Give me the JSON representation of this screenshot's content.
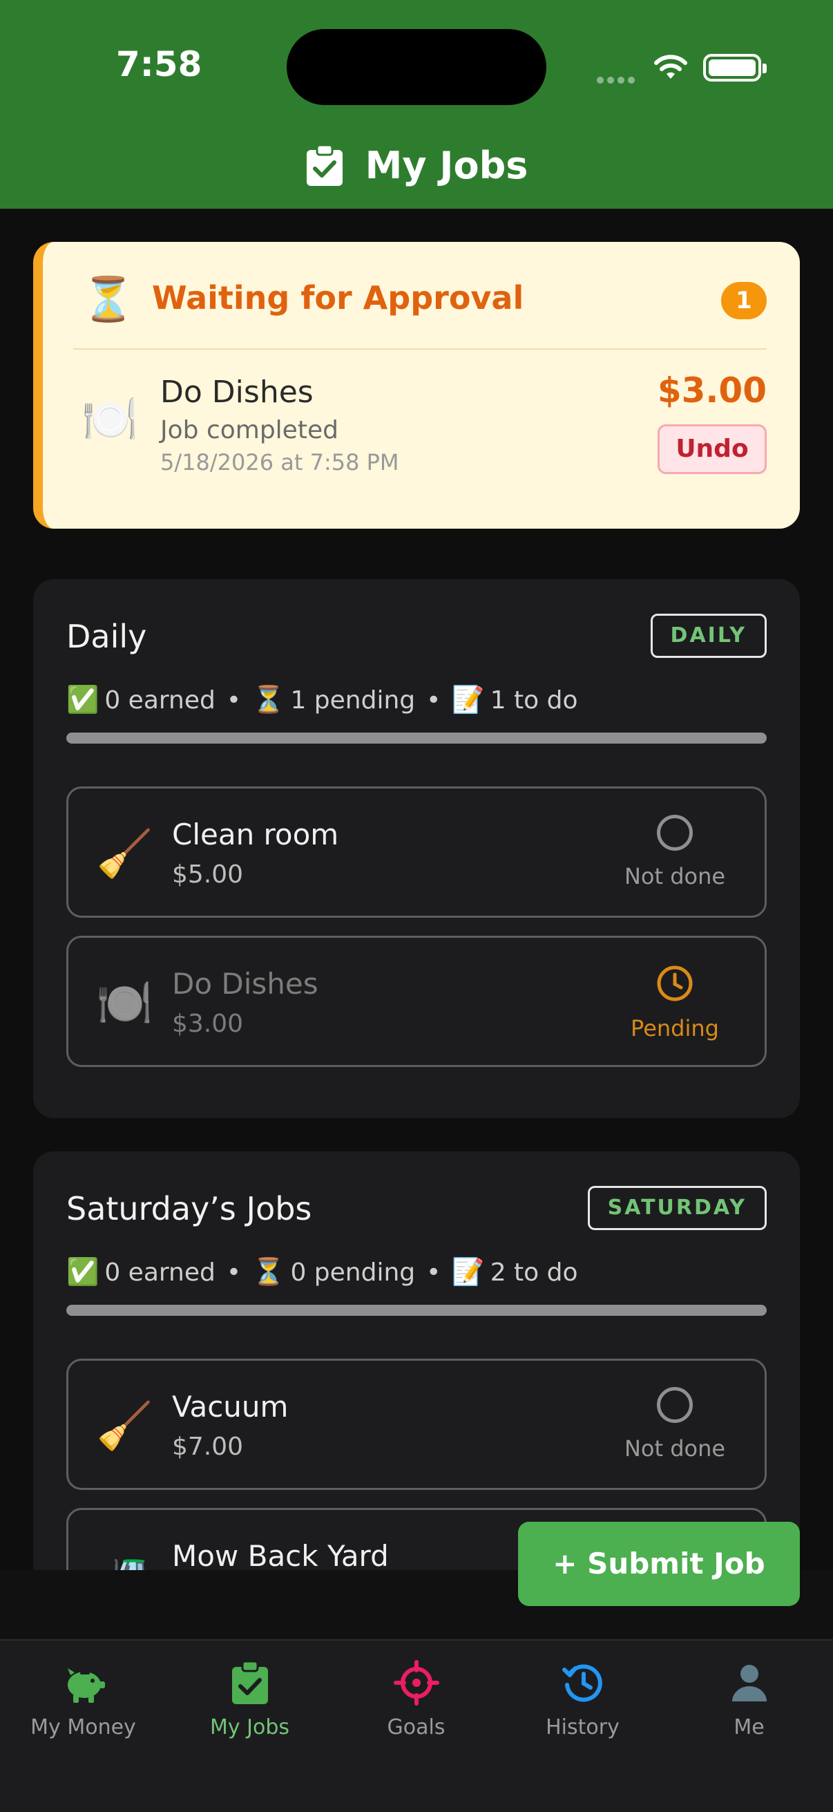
{
  "status_bar": {
    "time": "7:58"
  },
  "header": {
    "title": "My Jobs"
  },
  "approval": {
    "heading": "Waiting for Approval",
    "count": "1",
    "item": {
      "icon": "🍽️",
      "name": "Do Dishes",
      "status": "Job completed",
      "timestamp": "5/18/2026 at 7:58 PM",
      "amount": "$3.00",
      "undo_label": "Undo"
    }
  },
  "sections": [
    {
      "title": "Daily",
      "tag": "DAILY",
      "stats": {
        "earned": "0 earned",
        "pending": "1 pending",
        "todo": "1 to do"
      },
      "progress": 0,
      "jobs": [
        {
          "icon": "🧹",
          "name": "Clean room",
          "price": "$5.00",
          "state": "Not done"
        },
        {
          "icon": "🍽️",
          "name": "Do Dishes",
          "price": "$3.00",
          "state": "Pending"
        }
      ]
    },
    {
      "title": "Saturday’s Jobs",
      "tag": "SATURDAY",
      "stats": {
        "earned": "0 earned",
        "pending": "0 pending",
        "todo": "2 to do"
      },
      "progress": 0,
      "jobs": [
        {
          "icon": "🧹",
          "name": "Vacuum",
          "price": "$7.00",
          "state": "Not done"
        },
        {
          "icon": "🚜",
          "name": "Mow Back Yard",
          "price": "",
          "state": ""
        }
      ]
    }
  ],
  "submit_button": {
    "label": "+ Submit Job"
  },
  "tabs": [
    {
      "label": "My Money",
      "icon": "piggy-bank-icon"
    },
    {
      "label": "My Jobs",
      "icon": "clipboard-check-icon",
      "active": true
    },
    {
      "label": "Goals",
      "icon": "target-icon"
    },
    {
      "label": "History",
      "icon": "history-icon"
    },
    {
      "label": "Me",
      "icon": "person-icon"
    }
  ],
  "colors": {
    "header": "#2e7d2e",
    "accent_green": "#4caf50",
    "approval_bg": "#fff8dc",
    "approval_orange": "#e0620f",
    "pending": "#d98a17",
    "goals": "#e91e63",
    "history": "#2196f3"
  }
}
